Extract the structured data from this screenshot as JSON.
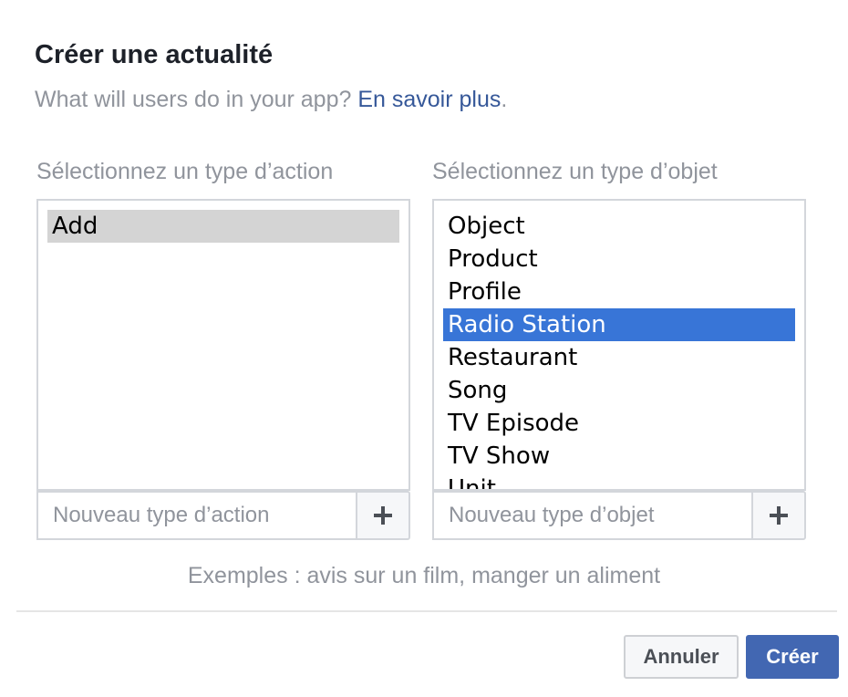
{
  "dialog": {
    "title": "Créer une actualité",
    "subtitle_text": "What will users do in your app? ",
    "subtitle_link": "En savoir plus",
    "subtitle_period": "."
  },
  "action_column": {
    "label": "Sélectionnez un type d’action",
    "items": [
      {
        "label": "Add",
        "selected": true
      }
    ],
    "new_placeholder": "Nouveau type d’action",
    "add_icon": "plus-icon"
  },
  "object_column": {
    "label": "Sélectionnez un type d’objet",
    "items": [
      {
        "label": "Object",
        "selected": false
      },
      {
        "label": "Product",
        "selected": false
      },
      {
        "label": "Profile",
        "selected": false
      },
      {
        "label": "Radio Station",
        "selected": true
      },
      {
        "label": "Restaurant",
        "selected": false
      },
      {
        "label": "Song",
        "selected": false
      },
      {
        "label": "TV Episode",
        "selected": false
      },
      {
        "label": "TV Show",
        "selected": false
      },
      {
        "label": "Unit",
        "selected": false
      }
    ],
    "new_placeholder": "Nouveau type d’objet",
    "add_icon": "plus-icon"
  },
  "examples_text": "Exemples : avis sur un film, manger un aliment",
  "footer": {
    "cancel_label": "Annuler",
    "create_label": "Créer"
  },
  "colors": {
    "link": "#365899",
    "selection_blue": "#3875d7",
    "selection_gray": "#d4d4d4",
    "primary_button": "#4267b2"
  }
}
